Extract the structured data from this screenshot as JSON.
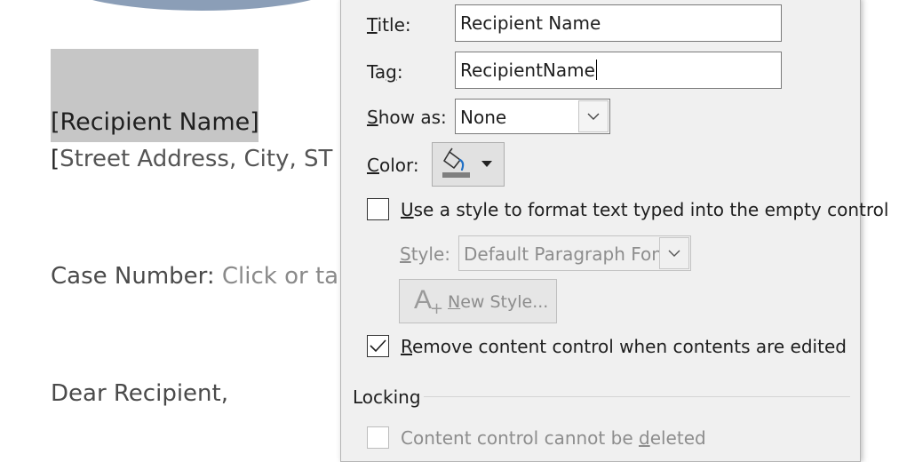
{
  "document": {
    "recipient_name": "[Recipient Name]",
    "street_line_bracket": "[",
    "street_line_text": "Street Address, City, ST",
    "case_label": "Case Number:",
    "case_placeholder": "Click or ta",
    "salutation": "Dear Recipient,"
  },
  "dialog": {
    "title_label_prefix": "",
    "title_label_accel": "T",
    "title_label_rest": "itle:",
    "title_value": "Recipient Name",
    "tag_label_pre": "Ta",
    "tag_label_accel": "g",
    "tag_label_rest": ":",
    "tag_value": "RecipientName",
    "show_as_accel": "S",
    "show_as_rest": "how as:",
    "show_as_value": "None",
    "color_accel": "C",
    "color_rest": "olor:",
    "use_style_accel": "U",
    "use_style_rest": "se a style to format text typed into the empty control",
    "use_style_checked": false,
    "style_accel": "S",
    "style_rest": "tyle:",
    "style_value": "Default Paragraph Font",
    "new_style_accel": "N",
    "new_style_rest": "ew Style...",
    "remove_pre": "",
    "remove_accel": "R",
    "remove_rest": "emove content control when contents are edited",
    "remove_checked": true,
    "locking_heading": "Locking",
    "cannot_delete_pre": "Content control cannot be ",
    "cannot_delete_accel": "d",
    "cannot_delete_rest": "eleted",
    "cannot_delete_checked": false
  },
  "colors": {
    "header_oval": "#8b9eb7",
    "highlight": "#c6c6c6",
    "fill_color_swatch": "#7f7f7f",
    "fill_accent": "#1f6fc5"
  }
}
